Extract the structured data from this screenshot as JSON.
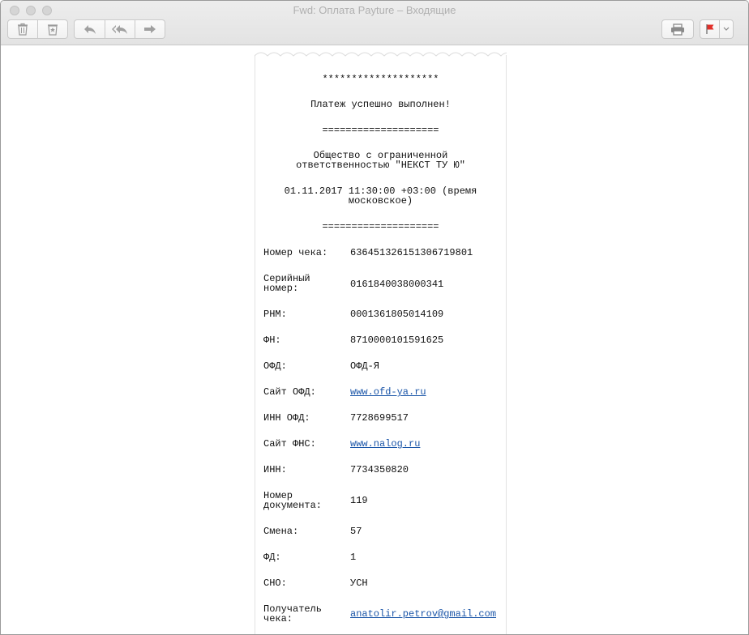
{
  "window": {
    "title": "Fwd: Оплата Payture – Входящие"
  },
  "toolbar": {
    "icons": {
      "delete": "trash-icon",
      "junk": "junk-icon",
      "reply": "reply-icon",
      "reply_all": "reply-all-icon",
      "forward": "forward-icon",
      "print": "printer-icon",
      "flag": "flag-icon",
      "flag_menu": "chevron-down-icon"
    },
    "flag_color": "#e2302a"
  },
  "receipt": {
    "stars": "********************",
    "status": "Платеж успешно выполнен!",
    "divider1": "====================",
    "company": "Общество с ограниченной\nответственностью \"НЕКСТ ТУ Ю\"",
    "datetime": "01.11.2017 11:30:00 +03:00 (время\nмосковское)",
    "divider2": "====================",
    "link_color": "#1a55a8",
    "rows": [
      {
        "label": "Номер чека:",
        "value": "636451326151306719801"
      },
      {
        "label": "Серийный номер:",
        "value": "0161840038000341"
      },
      {
        "label": "РНМ:",
        "value": "0001361805014109"
      },
      {
        "label": "ФН:",
        "value": "8710000101591625"
      },
      {
        "label": "ОФД:",
        "value": "ОФД-Я"
      },
      {
        "label": "Сайт ОФД:",
        "value": "www.ofd-ya.ru"
      },
      {
        "label": "ИНН ОФД:",
        "value": "7728699517"
      },
      {
        "label": "Сайт ФНС:",
        "value": "www.nalog.ru"
      },
      {
        "label": "ИНН:",
        "value": "7734350820"
      },
      {
        "label": "Номер документа:",
        "value": "119"
      },
      {
        "label": "Смена:",
        "value": "57"
      },
      {
        "label": "ФД:",
        "value": "1"
      },
      {
        "label": "СНО:",
        "value": "УСН"
      },
      {
        "label": "Получатель чека:",
        "value": "anatolir.petrov@gmail.com"
      }
    ]
  }
}
